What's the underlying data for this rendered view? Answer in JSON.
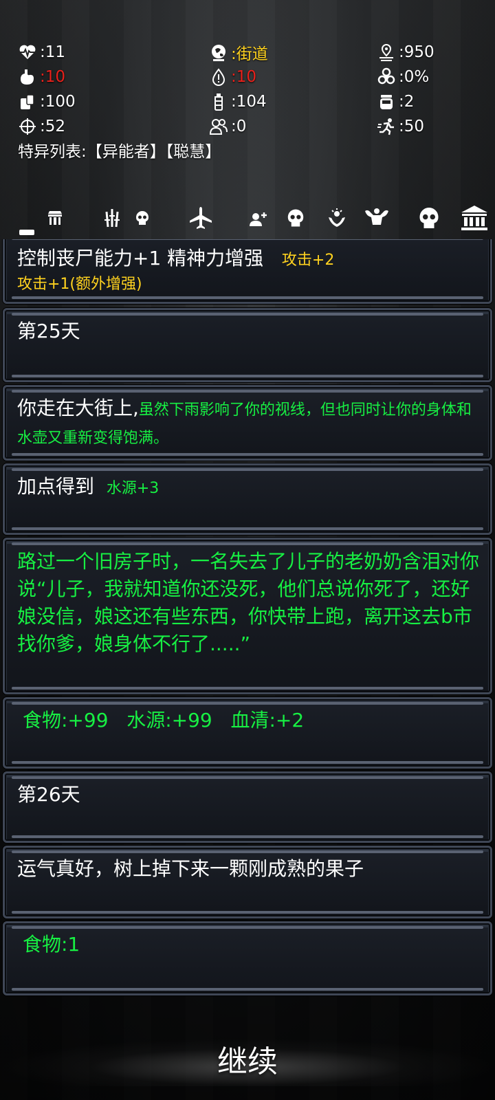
{
  "stats": {
    "hp": ":11",
    "location": ":街道",
    "distance": ":950",
    "hunger": ":10",
    "thirst": ":10",
    "infection": ":0%",
    "food": ":100",
    "water": ":104",
    "serum": ":2",
    "attack": ":52",
    "followers": ":0",
    "speed": ":50"
  },
  "special_list": "特异列表:【异能者】【聪慧】",
  "toolbar": {
    "icons": [
      "market-icon",
      "weapons-icon",
      "skull-small-icon",
      "plane-icon",
      "add-user-icon",
      "skull-icon",
      "healing-hands-icon",
      "muscle-icon",
      "skull-large-icon",
      "bank-icon"
    ]
  },
  "log": {
    "c1_main": "控制丧尸能力+1 精神力增强",
    "c1_extra": "攻击+2",
    "c1_line2": "攻击+1(额外增强)",
    "c2": "第25天",
    "c3_white": "你走在大街上,",
    "c3_green": "虽然下雨影响了你的视线，但也同时让你的身体和水壶又重新变得饱满。",
    "c4_white": "加点得到",
    "c4_green": "水源+3",
    "c5": "路过一个旧房子时，一名失去了儿子的老奶奶含泪对你说“儿子，我就知道你还没死，他们总说你死了，还好娘没信，娘这还有些东西，你快带上跑，离开这去b市找你爹，娘身体不行了.....”",
    "c6": "食物:+99   水源:+99   血清:+2",
    "c7": "第26天",
    "c8": "运气真好，树上掉下来一颗刚成熟的果子",
    "c9": "食物:1"
  },
  "continue_label": "继续",
  "colors": {
    "green": "#17f043",
    "yellow": "#ffd21f",
    "red": "#e8201a"
  }
}
